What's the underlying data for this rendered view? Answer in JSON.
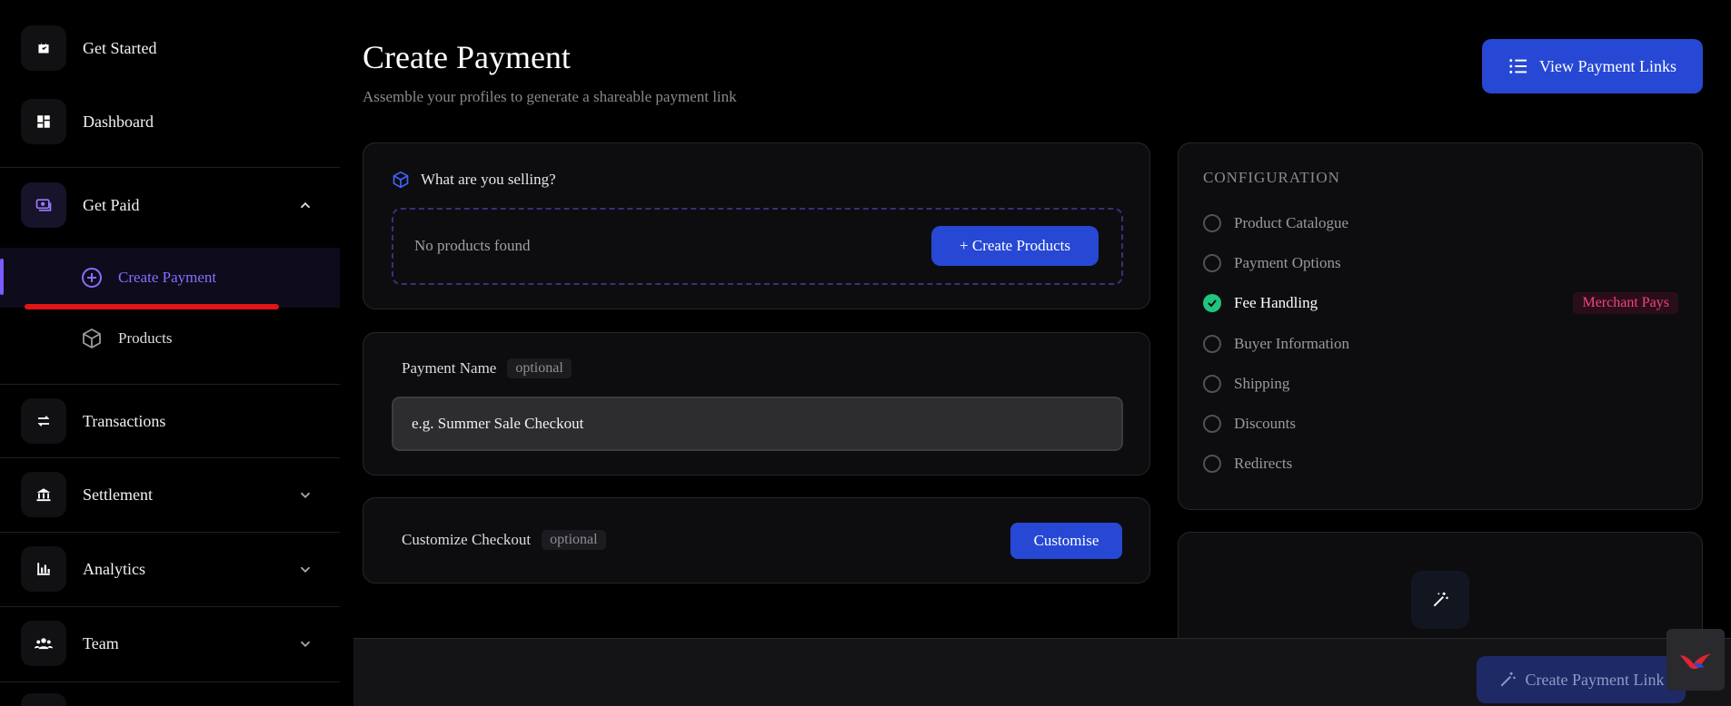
{
  "sidebar": {
    "get_started": "Get Started",
    "dashboard": "Dashboard",
    "get_paid": "Get Paid",
    "create_payment": "Create Payment",
    "products": "Products",
    "transactions": "Transactions",
    "settlement": "Settlement",
    "analytics": "Analytics",
    "team": "Team",
    "icons": {
      "get_started": "briefcase-icon",
      "dashboard": "dashboard-icon",
      "get_paid": "money-icon",
      "create_payment": "plus-circle-icon",
      "products": "box-icon",
      "transactions": "arrows-exchange-icon",
      "settlement": "bank-icon",
      "analytics": "bar-chart-icon",
      "team": "team-icon"
    }
  },
  "header": {
    "title": "Create Payment",
    "subtitle": "Assemble your profiles to generate a shareable payment link",
    "view_links_label": "View Payment Links"
  },
  "selling": {
    "heading": "What are you selling?",
    "empty": "No products found",
    "create_label": "+ Create Products"
  },
  "payment_name": {
    "label": "Payment Name",
    "optional": "optional",
    "placeholder": "e.g. Summer Sale Checkout"
  },
  "customize": {
    "label": "Customize Checkout",
    "optional": "optional",
    "button": "Customise"
  },
  "configuration": {
    "title": "CONFIGURATION",
    "items": [
      {
        "label": "Product Catalogue",
        "done": false
      },
      {
        "label": "Payment Options",
        "done": false
      },
      {
        "label": "Fee Handling",
        "done": true,
        "badge": "Merchant Pays"
      },
      {
        "label": "Buyer Information",
        "done": false
      },
      {
        "label": "Shipping",
        "done": false
      },
      {
        "label": "Discounts",
        "done": false
      },
      {
        "label": "Redirects",
        "done": false
      }
    ]
  },
  "footer": {
    "create_link_label": "Create Payment Link"
  },
  "colors": {
    "accent": "#2648d4",
    "purple": "#7c5cff",
    "success": "#1fc47e",
    "badge": "#f0457a",
    "underline": "#e01515"
  }
}
